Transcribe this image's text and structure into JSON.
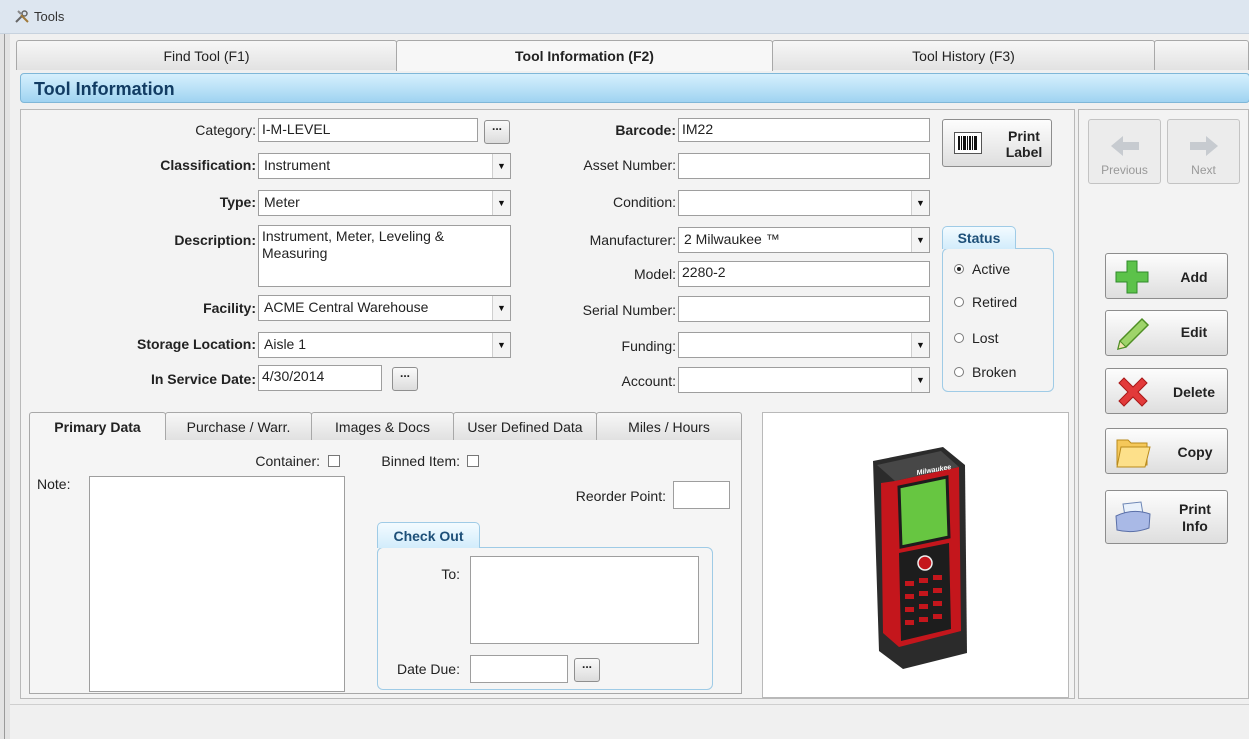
{
  "window": {
    "title": "Tools",
    "icon": "tools-icon"
  },
  "tabs": [
    {
      "label": "Find Tool (F1)"
    },
    {
      "label": "Tool Information (F2)"
    },
    {
      "label": "Tool History (F3)"
    }
  ],
  "section": {
    "title": "Tool Information"
  },
  "form": {
    "category": {
      "label": "Category:",
      "value": "I-M-LEVEL"
    },
    "classification": {
      "label": "Classification:",
      "value": "Instrument"
    },
    "type": {
      "label": "Type:",
      "value": "Meter"
    },
    "description": {
      "label": "Description:",
      "value": "Instrument, Meter, Leveling & Measuring"
    },
    "facility": {
      "label": "Facility:",
      "value": "ACME Central Warehouse"
    },
    "storage_location": {
      "label": "Storage Location:",
      "value": "Aisle 1"
    },
    "in_service_date": {
      "label": "In Service Date:",
      "value": "4/30/2014"
    },
    "barcode": {
      "label": "Barcode:",
      "value": "IM22"
    },
    "asset_number": {
      "label": "Asset Number:",
      "value": ""
    },
    "condition": {
      "label": "Condition:",
      "value": ""
    },
    "manufacturer": {
      "label": "Manufacturer:",
      "value": "2 Milwaukee ™"
    },
    "model": {
      "label": "Model:",
      "value": "2280-2"
    },
    "serial_number": {
      "label": "Serial Number:",
      "value": ""
    },
    "funding": {
      "label": "Funding:",
      "value": ""
    },
    "account": {
      "label": "Account:",
      "value": ""
    },
    "browse_button": "...",
    "print_label_button": {
      "line1": "Print",
      "line2": "Label",
      "icon": "barcode-icon"
    }
  },
  "status": {
    "title": "Status",
    "options": [
      "Active",
      "Retired",
      "Lost",
      "Broken"
    ],
    "selected": "Active"
  },
  "nav": {
    "previous": {
      "label": "Previous",
      "icon": "arrow-left-icon"
    },
    "next": {
      "label": "Next",
      "icon": "arrow-right-icon"
    }
  },
  "actions": {
    "add": {
      "label": "Add",
      "icon": "plus-icon"
    },
    "edit": {
      "label": "Edit",
      "icon": "pencil-icon"
    },
    "delete": {
      "label": "Delete",
      "icon": "x-icon"
    },
    "copy": {
      "label": "Copy",
      "icon": "folder-icon"
    },
    "print_info": {
      "line1": "Print",
      "line2": "Info",
      "icon": "printer-icon"
    }
  },
  "subtabs": [
    {
      "label": "Primary Data"
    },
    {
      "label": "Purchase / Warr."
    },
    {
      "label": "Images & Docs"
    },
    {
      "label": "User Defined Data"
    },
    {
      "label": "Miles / Hours"
    }
  ],
  "primary": {
    "container_label": "Container:",
    "container_checked": false,
    "binned_label": "Binned Item:",
    "binned_checked": false,
    "note_label": "Note:",
    "note_value": "",
    "reorder_label": "Reorder Point:",
    "reorder_value": ""
  },
  "checkout": {
    "title": "Check Out",
    "to_label": "To:",
    "to_value": "",
    "date_due_label": "Date Due:",
    "date_due_value": ""
  },
  "image": {
    "icon": "laser-distance-meter-image",
    "brand": "Milwaukee"
  },
  "colors": {
    "header_blue": "#9fd3f1",
    "header_text": "#123c63",
    "product_red": "#c4161c",
    "screen_green": "#67c641"
  }
}
